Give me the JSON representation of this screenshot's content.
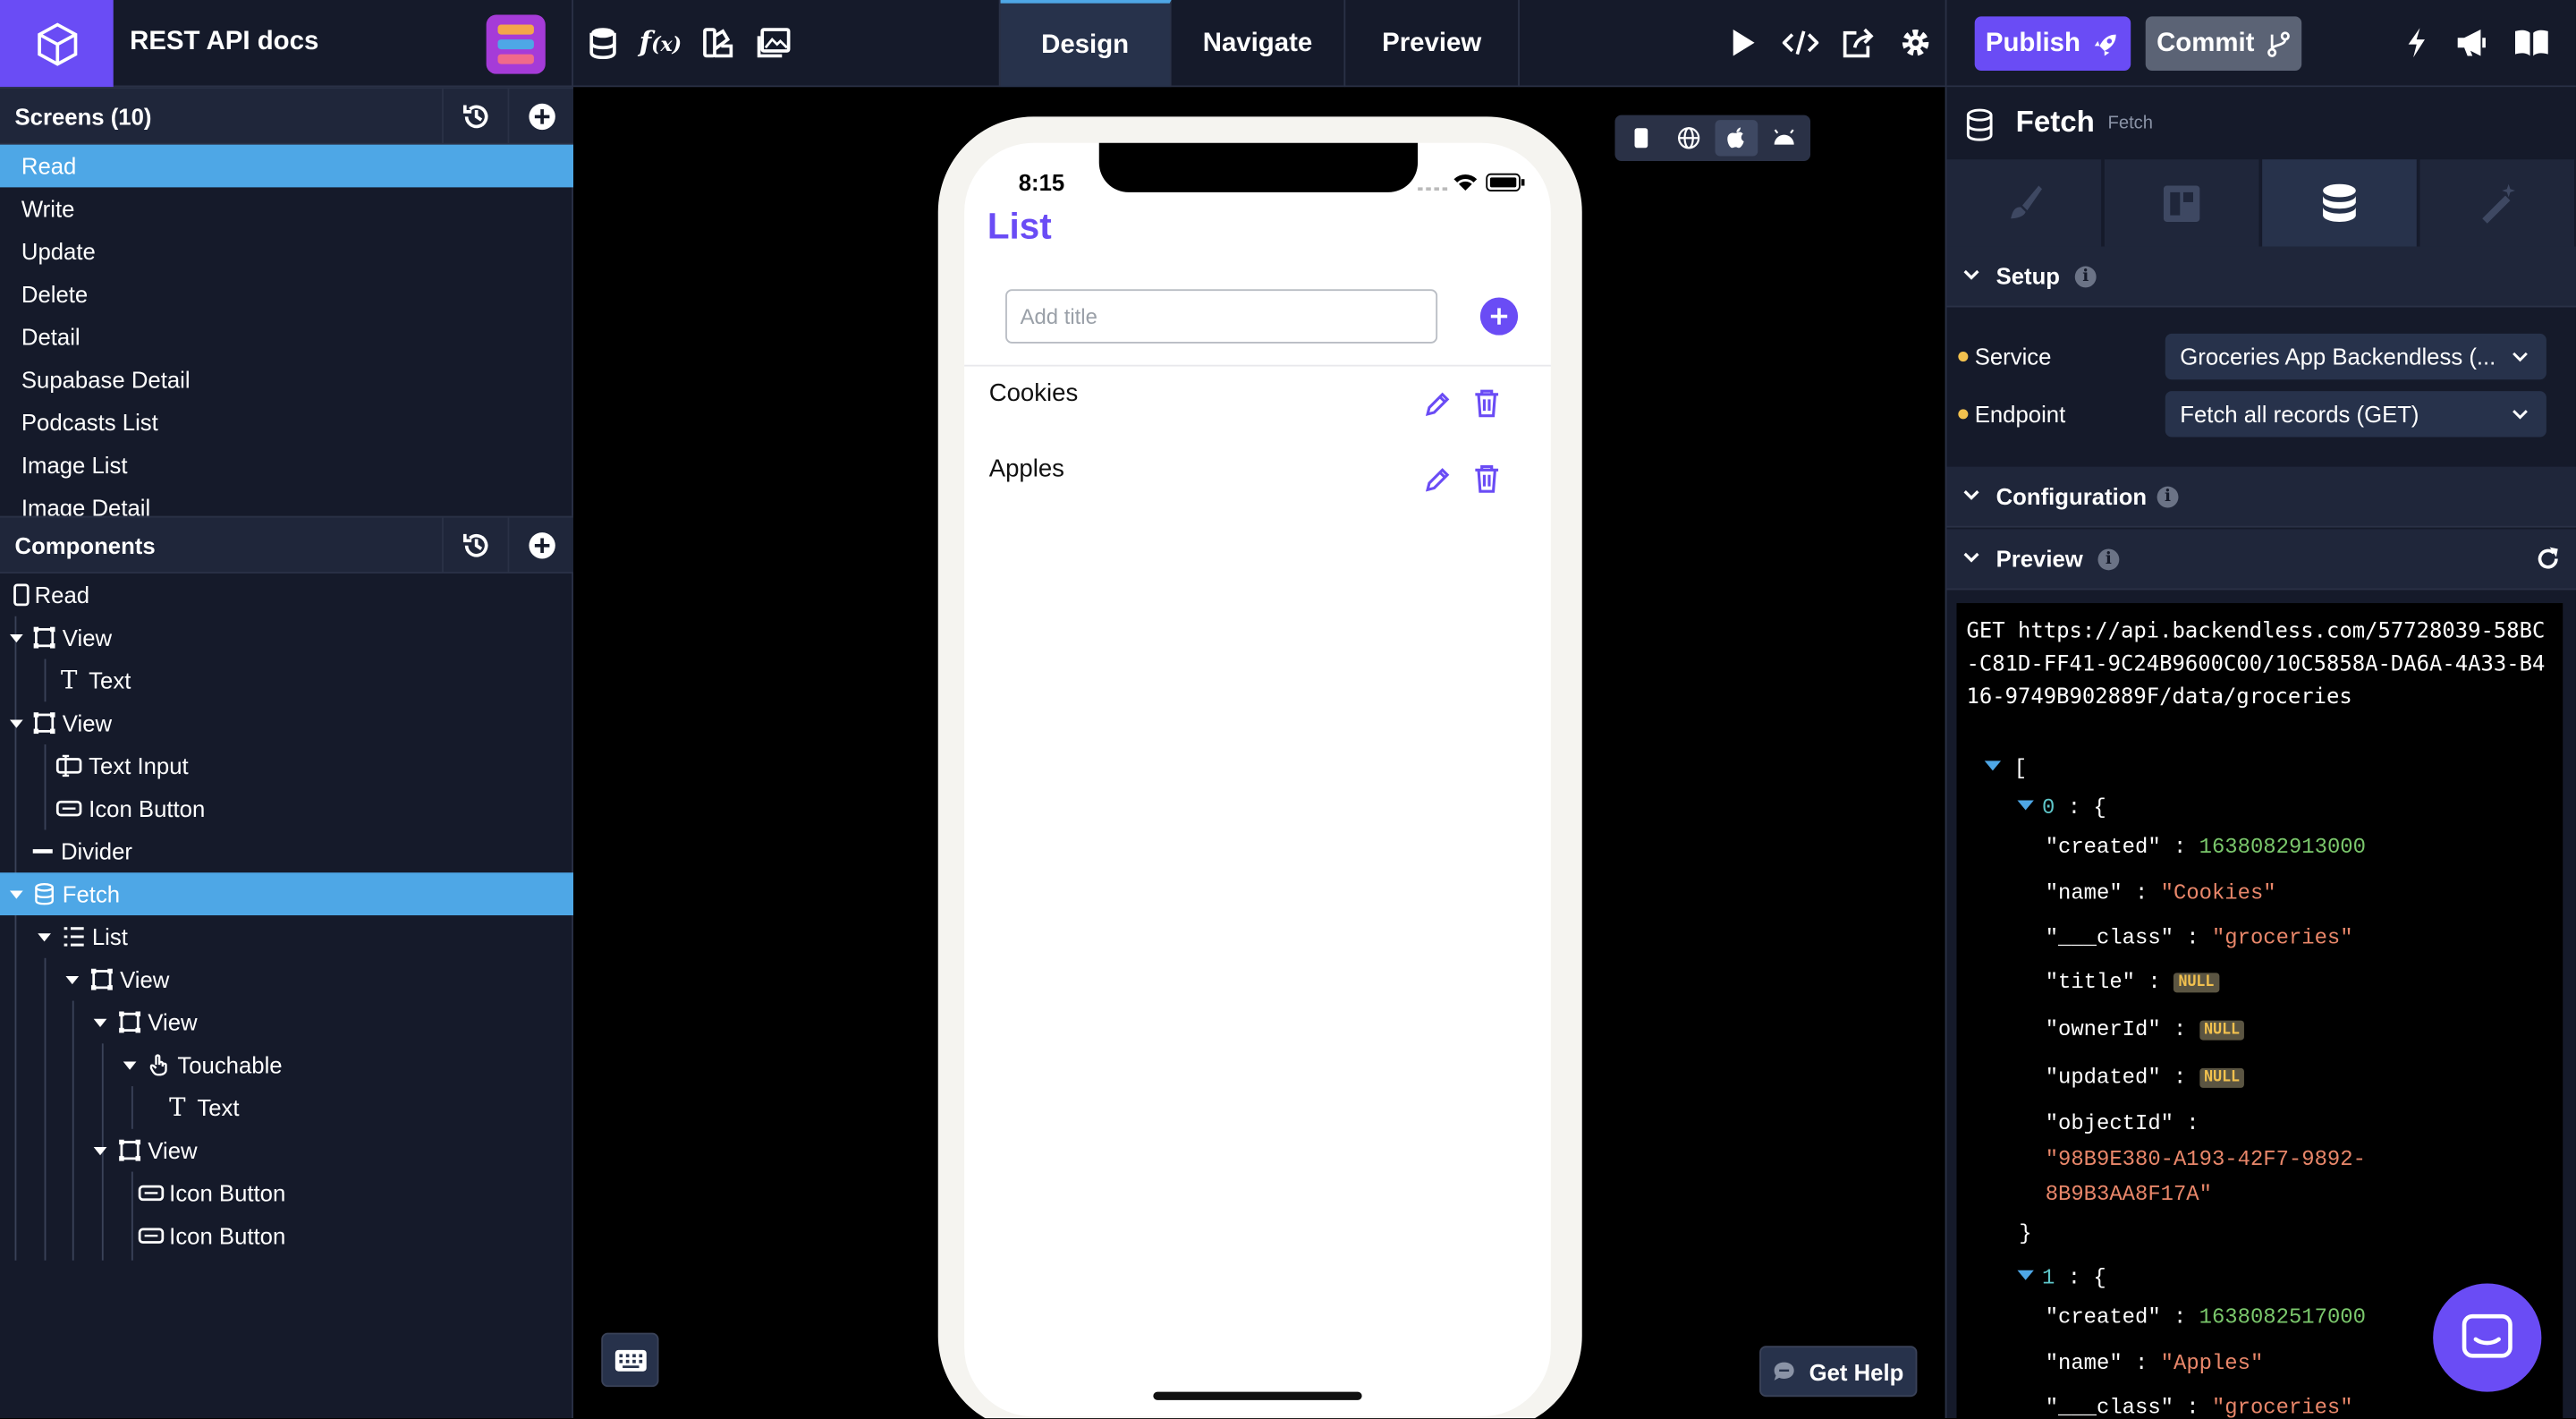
{
  "header": {
    "project_title": "REST API docs",
    "mode_tabs": [
      "Design",
      "Navigate",
      "Preview"
    ],
    "publish_label": "Publish",
    "commit_label": "Commit"
  },
  "screens": {
    "title": "Screens (10)",
    "items": [
      "Read",
      "Write",
      "Update",
      "Delete",
      "Detail",
      "Supabase Detail",
      "Podcasts List",
      "Image List",
      "Image Detail"
    ],
    "selected": "Read"
  },
  "components": {
    "title": "Components",
    "tree": [
      {
        "label": "Read",
        "icon": "phone-icon"
      },
      {
        "label": "View",
        "icon": "view-icon"
      },
      {
        "label": "Text",
        "icon": "text-icon"
      },
      {
        "label": "View",
        "icon": "view-icon"
      },
      {
        "label": "Text Input",
        "icon": "text-input-icon"
      },
      {
        "label": "Icon Button",
        "icon": "icon-button-icon"
      },
      {
        "label": "Divider",
        "icon": "divider-icon"
      },
      {
        "label": "Fetch",
        "icon": "database-icon"
      },
      {
        "label": "List",
        "icon": "list-icon"
      },
      {
        "label": "View",
        "icon": "view-icon"
      },
      {
        "label": "View",
        "icon": "view-icon"
      },
      {
        "label": "Touchable",
        "icon": "touchable-icon"
      },
      {
        "label": "Text",
        "icon": "text-icon"
      },
      {
        "label": "View",
        "icon": "view-icon"
      },
      {
        "label": "Icon Button",
        "icon": "icon-button-icon"
      },
      {
        "label": "Icon Button",
        "icon": "icon-button-icon"
      }
    ],
    "selected": "Fetch"
  },
  "phone": {
    "time": "8:15",
    "title": "List",
    "input_placeholder": "Add title",
    "rows": [
      {
        "text": "Cookies"
      },
      {
        "text": "Apples"
      }
    ]
  },
  "canvas": {
    "get_help_label": "Get Help"
  },
  "right_panel": {
    "title": "Fetch",
    "subtitle": "Fetch",
    "sections": {
      "setup": "Setup",
      "configuration": "Configuration",
      "preview": "Preview"
    },
    "service_label": "Service",
    "service_value": "Groceries App Backendless (...",
    "endpoint_label": "Endpoint",
    "endpoint_value": "Fetch all records (GET)",
    "request_text": "GET https://api.backendless.com/57728039-58BC-C81D-FF41-9C24B9600C00/10C5858A-DA6A-4A33-B416-9749B902889F/data/groceries",
    "json": {
      "open_bracket": "[",
      "item0_index": "0",
      "created0_key": "\"created\"",
      "created0_val": "1638082913000",
      "name0_key": "\"name\"",
      "name0_val": "\"Cookies\"",
      "class0_key": "\"___class\"",
      "class0_val": "\"groceries\"",
      "title_key": "\"title\"",
      "ownerId_key": "\"ownerId\"",
      "updated_key": "\"updated\"",
      "null_label": "NULL",
      "objectId_key": "\"objectId\"",
      "objectId_val_1": "\"98B9E380-A193-42F7-9892-",
      "objectId_val_2": "8B9B3AA8F17A\"",
      "close_brace": "}",
      "item1_index": "1",
      "created1_val": "1638082517000",
      "name1_val": "\"Apples\"",
      "class1_val": "\"groceries\""
    }
  },
  "colors": {
    "accent": "#6a4cf5",
    "selection": "#4ea7e6",
    "panel_bg": "#151a2a"
  }
}
